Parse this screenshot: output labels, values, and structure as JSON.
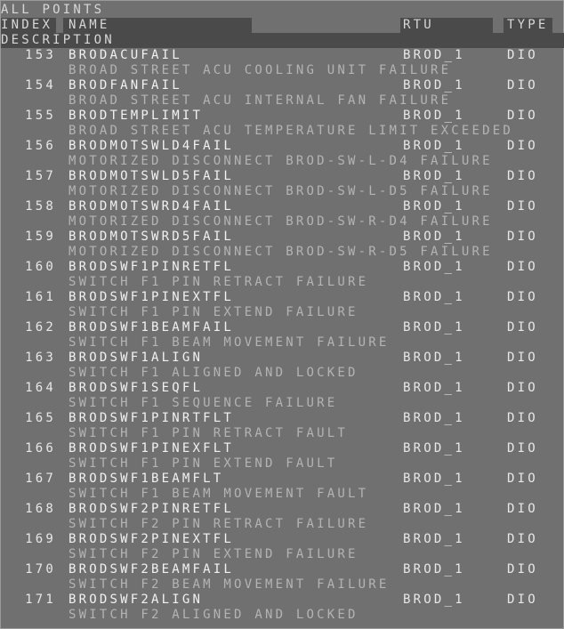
{
  "window": {
    "title": "ALL POINTS"
  },
  "columns": {
    "index": "INDEX",
    "name": "NAME",
    "rtu": "RTU",
    "type": "TYPE",
    "description": "DESCRIPTION"
  },
  "points": [
    {
      "index": "153",
      "name": "BRODACUFAIL",
      "rtu": "BROD_1",
      "type": "DIO",
      "description": "BROAD STREET ACU COOLING UNIT FAILURE"
    },
    {
      "index": "154",
      "name": "BRODFANFAIL",
      "rtu": "BROD_1",
      "type": "DIO",
      "description": "BROAD STREET ACU INTERNAL FAN FAILURE"
    },
    {
      "index": "155",
      "name": "BRODTEMPLIMIT",
      "rtu": "BROD_1",
      "type": "DIO",
      "description": "BROAD STREET ACU TEMPERATURE LIMIT EXCEEDED"
    },
    {
      "index": "156",
      "name": "BRODMOTSWLD4FAIL",
      "rtu": "BROD_1",
      "type": "DIO",
      "description": "MOTORIZED DISCONNECT BROD-SW-L-D4 FAILURE"
    },
    {
      "index": "157",
      "name": "BRODMOTSWLD5FAIL",
      "rtu": "BROD_1",
      "type": "DIO",
      "description": "MOTORIZED DISCONNECT BROD-SW-L-D5 FAILURE"
    },
    {
      "index": "158",
      "name": "BRODMOTSWRD4FAIL",
      "rtu": "BROD_1",
      "type": "DIO",
      "description": "MOTORIZED DISCONNECT BROD-SW-R-D4 FAILURE"
    },
    {
      "index": "159",
      "name": "BRODMOTSWRD5FAIL",
      "rtu": "BROD_1",
      "type": "DIO",
      "description": "MOTORIZED DISCONNECT BROD-SW-R-D5 FAILURE"
    },
    {
      "index": "160",
      "name": "BRODSWF1PINRETFL",
      "rtu": "BROD_1",
      "type": "DIO",
      "description": "SWITCH F1 PIN RETRACT FAILURE"
    },
    {
      "index": "161",
      "name": "BRODSWF1PINEXTFL",
      "rtu": "BROD_1",
      "type": "DIO",
      "description": "SWITCH F1 PIN EXTEND FAILURE"
    },
    {
      "index": "162",
      "name": "BRODSWF1BEAMFAIL",
      "rtu": "BROD_1",
      "type": "DIO",
      "description": "SWITCH F1 BEAM MOVEMENT FAILURE"
    },
    {
      "index": "163",
      "name": "BRODSWF1ALIGN",
      "rtu": "BROD_1",
      "type": "DIO",
      "description": "SWITCH F1 ALIGNED AND LOCKED"
    },
    {
      "index": "164",
      "name": "BRODSWF1SEQFL",
      "rtu": "BROD_1",
      "type": "DIO",
      "description": "SWITCH F1 SEQUENCE FAILURE"
    },
    {
      "index": "165",
      "name": "BRODSWF1PINRTFLT",
      "rtu": "BROD_1",
      "type": "DIO",
      "description": "SWITCH F1 PIN RETRACT FAULT"
    },
    {
      "index": "166",
      "name": "BRODSWF1PINEXFLT",
      "rtu": "BROD_1",
      "type": "DIO",
      "description": "SWITCH F1 PIN EXTEND FAULT"
    },
    {
      "index": "167",
      "name": "BRODSWF1BEAMFLT",
      "rtu": "BROD_1",
      "type": "DIO",
      "description": "SWITCH F1 BEAM MOVEMENT FAULT"
    },
    {
      "index": "168",
      "name": "BRODSWF2PINRETFL",
      "rtu": "BROD_1",
      "type": "DIO",
      "description": "SWITCH F2 PIN RETRACT FAILURE"
    },
    {
      "index": "169",
      "name": "BRODSWF2PINEXTFL",
      "rtu": "BROD_1",
      "type": "DIO",
      "description": "SWITCH F2 PIN EXTEND FAILURE"
    },
    {
      "index": "170",
      "name": "BRODSWF2BEAMFAIL",
      "rtu": "BROD_1",
      "type": "DIO",
      "description": "SWITCH F2 BEAM MOVEMENT FAILURE"
    },
    {
      "index": "171",
      "name": "BRODSWF2ALIGN",
      "rtu": "BROD_1",
      "type": "DIO",
      "description": "SWITCH F2 ALIGNED AND LOCKED"
    }
  ]
}
